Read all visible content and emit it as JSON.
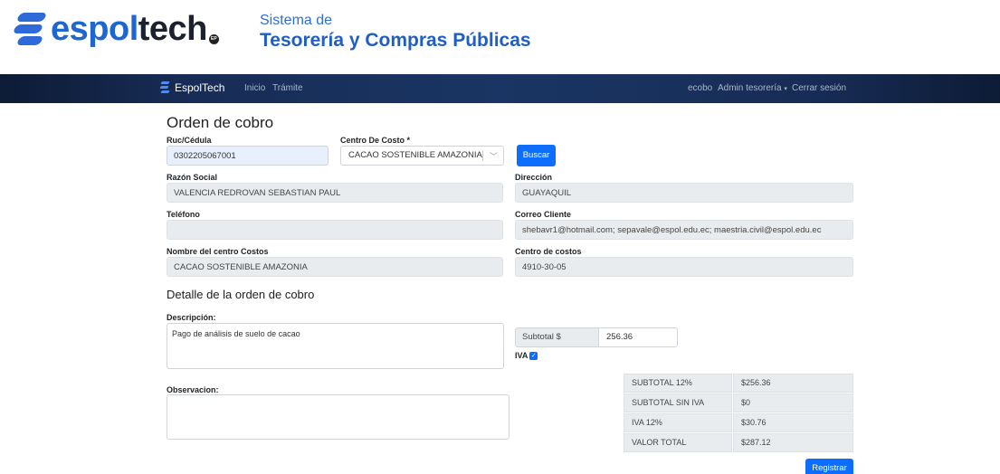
{
  "header": {
    "logo_espol": "espol",
    "logo_tech": "tech",
    "logo_badge": "EP",
    "system_small": "Sistema de",
    "system_big": "Tesorería y Compras Públicas"
  },
  "navbar": {
    "brand": "EspolTech",
    "links": [
      "Inicio",
      "Trámite"
    ],
    "user": "ecobo",
    "role_menu": "Admin tesorería",
    "logout": "Cerrar sesión"
  },
  "form": {
    "title": "Orden de cobro",
    "ruc": {
      "label": "Ruc/Cédula",
      "value": "0302205067001"
    },
    "centro_costo": {
      "label": "Centro De Costo *",
      "value": "CACAO SOSTENIBLE AMAZONIA"
    },
    "search_button": "Buscar",
    "razon_social": {
      "label": "Razón Social",
      "value": "VALENCIA REDROVAN SEBASTIAN PAUL"
    },
    "direccion": {
      "label": "Dirección",
      "value": "GUAYAQUIL"
    },
    "telefono": {
      "label": "Teléfono",
      "value": ""
    },
    "correo": {
      "label": "Correo Cliente",
      "value": "shebavr1@hotmail.com; sepavale@espol.edu.ec; maestria.civil@espol.edu.ec"
    },
    "nombre_centro": {
      "label": "Nombre del centro Costos",
      "value": "CACAO SOSTENIBLE AMAZONIA"
    },
    "codigo_centro": {
      "label": "Centro de costos",
      "value": "4910-30-05"
    }
  },
  "detail": {
    "title": "Detalle de la orden de cobro",
    "descripcion": {
      "label": "Descripción:",
      "value": "Pago de análisis de suelo de cacao"
    },
    "observacion": {
      "label": "Observacion:",
      "value": ""
    },
    "subtotal": {
      "label": "Subtotal $",
      "value": "256.36"
    },
    "iva_label": "IVA",
    "iva_checked": true,
    "totals": [
      {
        "label": "SUBTOTAL 12%",
        "value": "$256.36"
      },
      {
        "label": "SUBTOTAL SIN IVA",
        "value": "$0"
      },
      {
        "label": "IVA 12%",
        "value": "$30.76"
      },
      {
        "label": "VALOR TOTAL",
        "value": "$287.12"
      }
    ],
    "register_button": "Registrar"
  },
  "colors": {
    "primary": "#0d6efd",
    "navbar": "#1a3563",
    "brand_blue": "#1e66d0"
  }
}
